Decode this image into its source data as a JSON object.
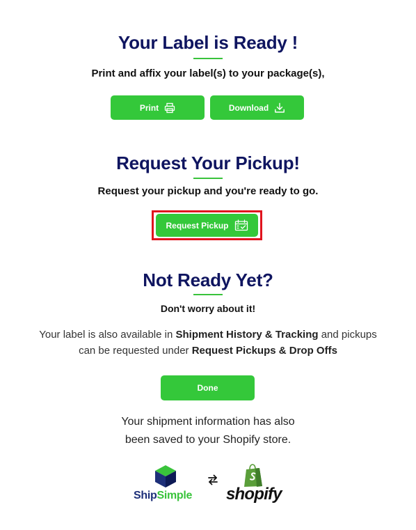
{
  "label_section": {
    "title": "Your Label is Ready !",
    "subtitle": "Print and affix your label(s) to your package(s),",
    "print_label": "Print",
    "download_label": "Download"
  },
  "pickup_section": {
    "title": "Request Your Pickup!",
    "subtitle": "Request your pickup and you're ready to go.",
    "request_label": "Request Pickup"
  },
  "not_ready_section": {
    "title": "Not Ready Yet?",
    "subtitle": "Don't worry about it!",
    "text_1": "Your label is also available in ",
    "bold_1": "Shipment History & Tracking",
    "text_2": " and pickups",
    "text_3": "can be requested under ",
    "bold_2": "Request Pickups & Drop Offs",
    "done_label": "Done"
  },
  "shopify_note": {
    "line_1": "Your shipment information has also",
    "line_2": "been saved to your Shopify store."
  },
  "logos": {
    "shipsimple_a": "Ship",
    "shipsimple_b": "Simple",
    "shopify": "shopify"
  },
  "colors": {
    "heading": "#0f1560",
    "accent_green": "#34c83a",
    "highlight_red": "#e0141e"
  }
}
